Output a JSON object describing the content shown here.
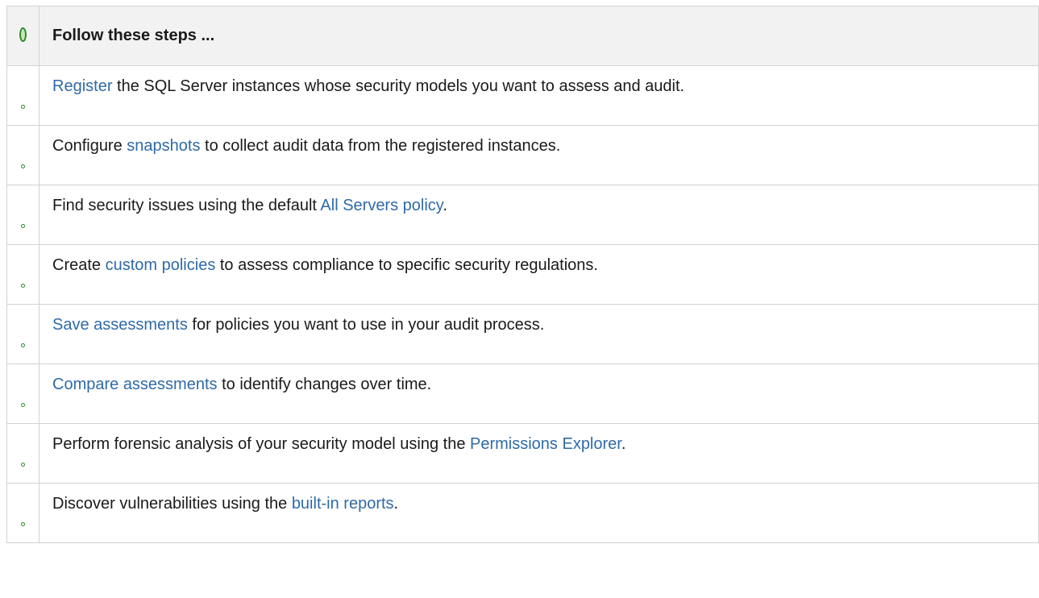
{
  "header": {
    "icon": "leaf-icon",
    "title": "Follow these steps ..."
  },
  "steps": [
    {
      "pre": "",
      "link": "Register",
      "post": " the SQL Server instances whose security models you want to assess and audit."
    },
    {
      "pre": "Configure ",
      "link": "snapshots",
      "post": " to collect audit data from the registered instances."
    },
    {
      "pre": "Find security issues using the default ",
      "link": "All Servers policy",
      "post": "."
    },
    {
      "pre": "Create ",
      "link": "custom policies",
      "post": " to assess compliance to specific security regulations."
    },
    {
      "pre": "",
      "link": "Save assessments",
      "post": " for policies you want to use in your audit process."
    },
    {
      "pre": "",
      "link": "Compare assessments",
      "post": " to identify changes over time."
    },
    {
      "pre": "Perform forensic analysis of your security model using the ",
      "link": "Permissions Explorer",
      "post": "."
    },
    {
      "pre": "Discover vulnerabilities using the ",
      "link": "built-in reports",
      "post": "."
    }
  ],
  "colors": {
    "link": "#2f6aa8",
    "header_bg": "#f2f2f2",
    "icon_green": "#2a8a2a"
  }
}
